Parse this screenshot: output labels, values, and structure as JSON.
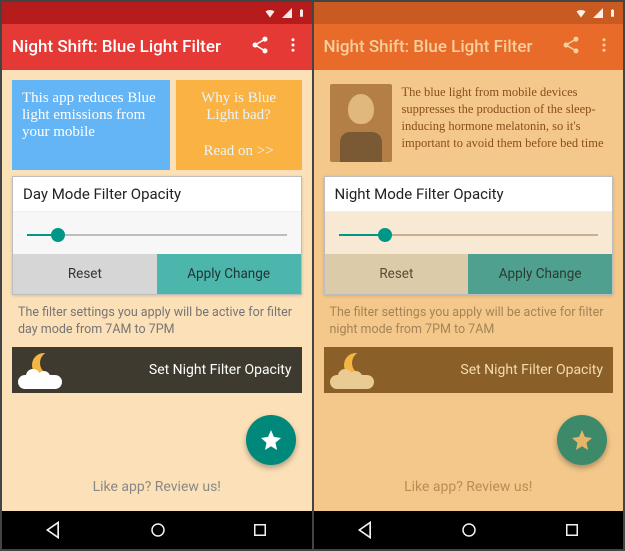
{
  "app": {
    "title": "Night Shift: Blue Light Filter"
  },
  "left": {
    "info_blue": "This app reduces Blue light emissions from your mobile",
    "info_orange_title": "Why is Blue Light bad?",
    "info_orange_link": "Read on >>",
    "card_title": "Day Mode Filter Opacity",
    "slider_percent": 12,
    "reset": "Reset",
    "apply": "Apply Change",
    "hint": "The filter settings you apply will be active for filter day mode from 7AM to 7PM",
    "night_bar": "Set Night Filter Opacity",
    "footer": "Like app? Review us!"
  },
  "right": {
    "quote": "The blue light from mobile devices suppresses the production of the sleep-inducing hormone melatonin, so it's important to avoid them before bed time",
    "card_title": "Night Mode Filter Opacity",
    "slider_percent": 18,
    "reset": "Reset",
    "apply": "Apply Change",
    "hint": "The filter settings you apply will be active for filter night mode from 7PM to 7AM",
    "night_bar": "Set Night Filter Opacity",
    "footer": "Like app? Review us!"
  }
}
